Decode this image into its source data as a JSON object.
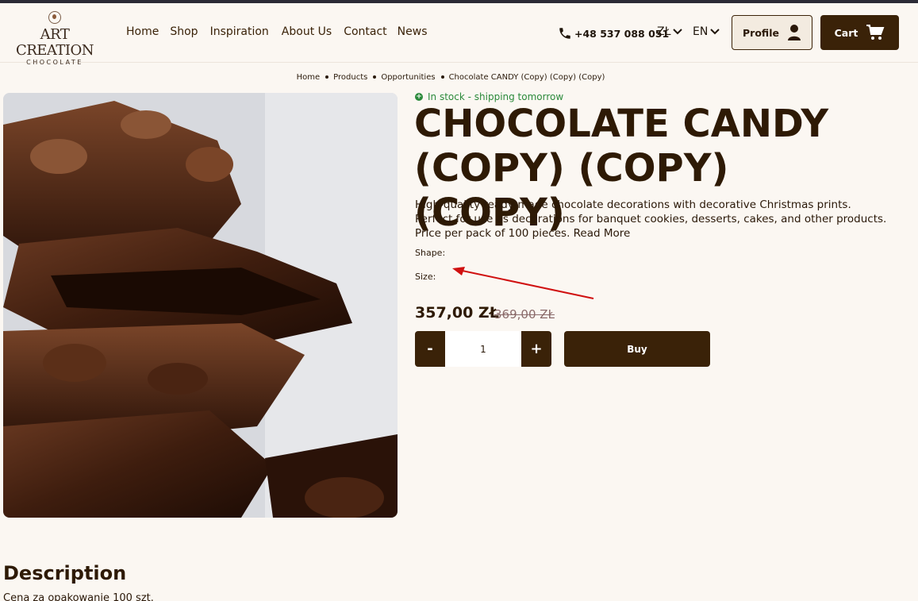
{
  "header": {
    "logo_name": "ART CREATION",
    "logo_sub": "CHOCOLATE",
    "nav": [
      "Home",
      "Shop",
      "Inspiration",
      "About Us",
      "Contact",
      "News"
    ],
    "phone": "+48 537 088 051",
    "currency": "ZŁ",
    "language": "EN",
    "profile_label": "Profile",
    "cart_label": "Cart"
  },
  "breadcrumb": [
    "Home",
    "Products",
    "Opportunities",
    "Chocolate CANDY (Copy) (Copy) (Copy)"
  ],
  "product": {
    "stock_status": "In stock - shipping tomorrow",
    "title": "CHOCOLATE CANDY (COPY) (COPY) (COPY)",
    "description": "High-quality ready-made chocolate decorations with decorative Christmas prints. Perfect for use as decorations for banquet cookies, desserts, cakes, and other products. Price per pack of 100 pieces. Read More",
    "shape_label": "Shape:",
    "size_label": "Size:",
    "price": "357,00 ZŁ",
    "old_price": "369,00 ZŁ",
    "quantity": "1",
    "minus_label": "-",
    "plus_label": "+",
    "buy_label": "Buy"
  },
  "description_section": {
    "heading": "Description",
    "text": "Cena za opakowanie 100 szt."
  },
  "colors": {
    "brand_dark": "#3a2208",
    "background": "#fbf7f2",
    "stock_green": "#2b8a3b",
    "annotation_red": "#d01010"
  }
}
